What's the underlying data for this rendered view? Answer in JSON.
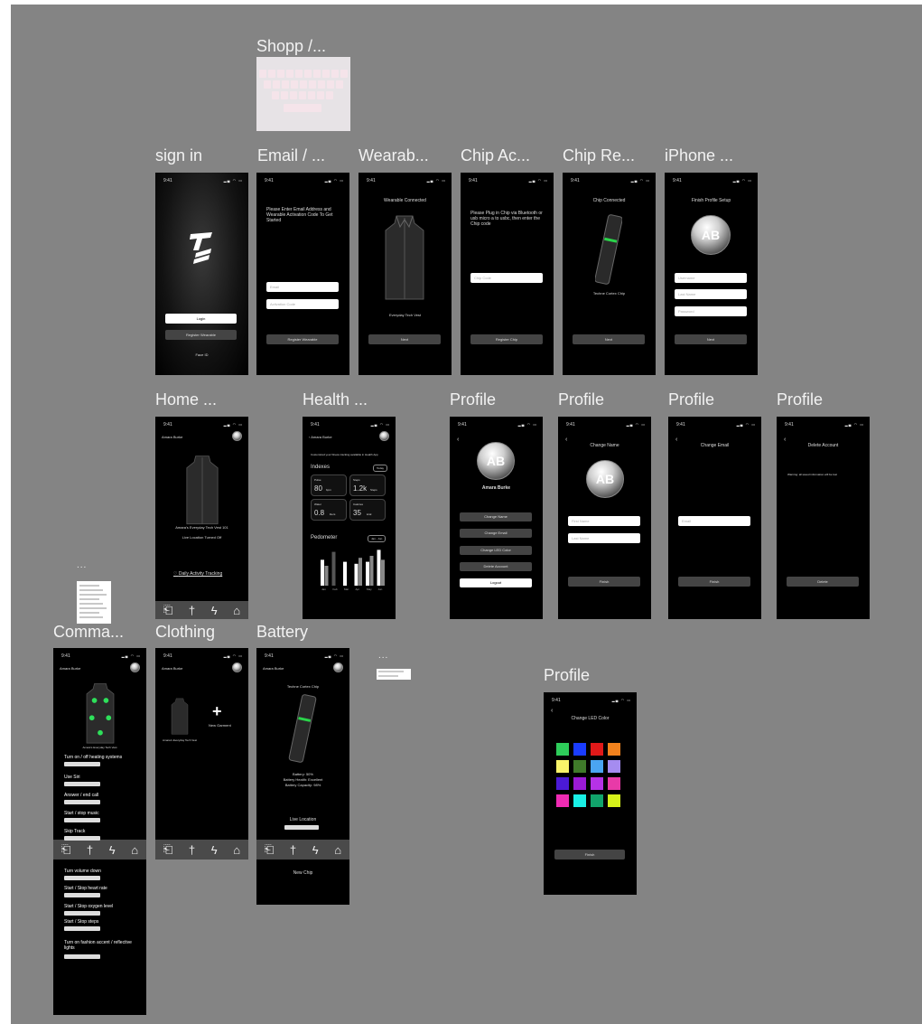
{
  "frames": {
    "shopp": {
      "title": "Shopp /..."
    },
    "signin": {
      "title": "sign in",
      "login": "Login",
      "register": "Register Wearable",
      "faceid": "Face ID"
    },
    "email": {
      "title": "Email / ...",
      "heading": "Please Enter Email Address and Wearable Activation Code To Get Started",
      "email_ph": "Email",
      "code_ph": "Activation Code",
      "button": "Register Wearable"
    },
    "wearable": {
      "title": "Wearab...",
      "heading": "Wearable Connected",
      "caption": "Everyday Tech Vest",
      "button": "Next"
    },
    "chipact": {
      "title": "Chip Ac...",
      "heading": "Please Plug in Chip via Bluetooth or usb micro a to usbc, then enter the Chip code",
      "code_ph": "Chip Code",
      "button": "Register Chip"
    },
    "chipreg": {
      "title": "Chip Re...",
      "heading": "Chip Connected",
      "caption": "Techne Cortex Chip",
      "button": "Next"
    },
    "iphone": {
      "title": "iPhone ...",
      "heading": "Finish Profile Setup",
      "initials": "AB",
      "f1": "Username",
      "f2": "Last Name",
      "f3": "Password",
      "button": "Next"
    },
    "home": {
      "title": "Home ...",
      "user": "Amara Burke",
      "caption1": "Amara's Everyday Tech Vest 101",
      "caption2": "Live Location Turned Off",
      "tracking": "Daily Activity Tracking"
    },
    "health": {
      "title": "Health ...",
      "user": "Amara Burke",
      "subtitle": "Customized your fitness tracking available in Health App",
      "indexes": "Indexes",
      "today": "Today",
      "pedometer": "Pedometer",
      "range": "Jan - Jun",
      "tiles": [
        {
          "label": "Pulse",
          "value": "80",
          "unit": "bpm"
        },
        {
          "label": "Steps",
          "value": "1.2k",
          "unit": "Steps"
        },
        {
          "label": "Water",
          "value": "0.8",
          "unit": "liters"
        },
        {
          "label": "Calories",
          "value": "35",
          "unit": "kcal"
        }
      ]
    },
    "profile1": {
      "title": "Profile",
      "initials": "AB",
      "name": "Amara Burke",
      "buttons": [
        "Change Name",
        "Change Email",
        "Change LED Color",
        "Delete Account",
        "Logout"
      ]
    },
    "profile2": {
      "title": "Profile",
      "heading": "Change Name",
      "initials": "AB",
      "f1": "First Name",
      "f2": "Last Name",
      "button": "Finish"
    },
    "profile3": {
      "title": "Profile",
      "heading": "Change Email",
      "f1": "Email",
      "button": "Finish"
    },
    "profile4": {
      "title": "Profile",
      "heading": "Delete Account",
      "warning": "Warning: all saved information will be lost",
      "button": "Delete"
    },
    "commands": {
      "title": "Comma...",
      "user": "Amara Burke",
      "caption": "Amara's Everyday Tech Vest",
      "items": [
        "Turn on / off heating systems",
        "Use Siri",
        "Answer / end call",
        "Start / stop music",
        "Skip Track",
        "Turn volume down",
        "Start / Stop heart rate",
        "Start / Stop oxygen level",
        "Start / Stop steps",
        "Turn on fashion accent / reflective lights"
      ]
    },
    "clothing": {
      "title": "Clothing",
      "user": "Amara Burke",
      "caption": "Amara's Everyday Tech Vest",
      "new": "New Garment"
    },
    "battery": {
      "title": "Battery",
      "user": "Amara Burke",
      "chip": "Techne Cortex Chip",
      "b1": "Battery: 50%",
      "b2": "Battery Health: Excellent",
      "b3": "Battery Capacity: 98%",
      "live": "Live Location",
      "newchip": "New Chip"
    },
    "led": {
      "title": "Profile",
      "heading": "Change LED Color",
      "button": "Finish",
      "colors": [
        "#2ecc5a",
        "#1a3cff",
        "#e01919",
        "#f2821d",
        "#f8f46a",
        "#3f7a2a",
        "#4aa5f2",
        "#a58cf0",
        "#4b1ad6",
        "#9b1ad6",
        "#b632e6",
        "#e83aa8",
        "#ef2bb3",
        "#19f0e6",
        "#11a36b",
        "#d6f21a"
      ]
    },
    "statusbar": {
      "time": "9:41",
      "icons": "▂▄ ◠ ▭"
    },
    "ellipsis": "...",
    "tabs": [
      "⎗",
      "†",
      "ϟ",
      "⌂"
    ]
  },
  "pedometer_chart": {
    "type": "bar",
    "categories": [
      "Jan",
      "Feb",
      "Mar",
      "Apr",
      "May",
      "Jun"
    ],
    "series": [
      {
        "values": [
          65,
          85,
          60,
          55,
          60,
          90
        ]
      },
      {
        "values": [
          50,
          0,
          0,
          70,
          75,
          65
        ]
      }
    ]
  }
}
